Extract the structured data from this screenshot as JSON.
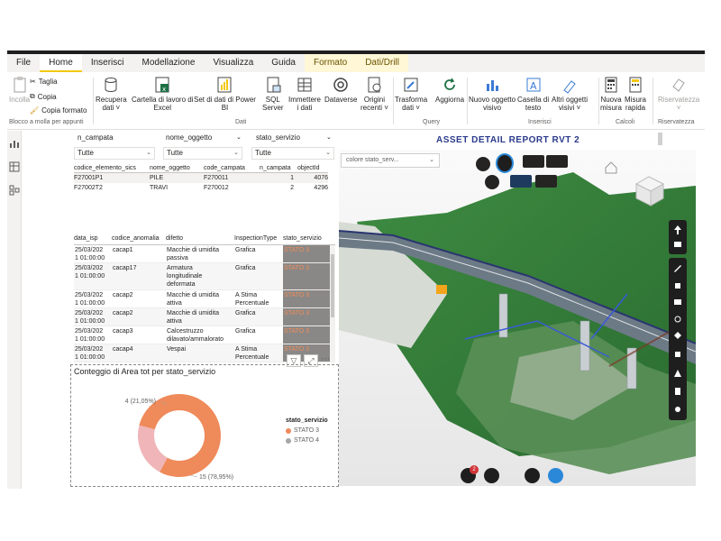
{
  "ribbon": {
    "tabs": [
      "File",
      "Home",
      "Inserisci",
      "Modellazione",
      "Visualizza",
      "Guida",
      "Formato",
      "Dati/Drill"
    ],
    "clipboard": {
      "incolla": "Incolla",
      "taglia": "Taglia",
      "copia": "Copia",
      "copia_formato": "Copia formato",
      "group": "Blocco a molla per appunti"
    },
    "data": {
      "recupera": [
        "Recupera",
        "dati ˅"
      ],
      "cartella": [
        "Cartella di lavoro di",
        "Excel"
      ],
      "setdati": [
        "Set di dati di Power",
        "BI"
      ],
      "sql": [
        "SQL",
        "Server"
      ],
      "immettere": [
        "Immettere",
        "i dati"
      ],
      "dataverse": "Dataverse",
      "origini": [
        "Origini",
        "recenti ˅"
      ],
      "group": "Dati"
    },
    "query": {
      "trasforma": [
        "Trasforma",
        "dati ˅"
      ],
      "aggiorna": "Aggiorna",
      "group": "Query"
    },
    "inserisci": {
      "nuovo": [
        "Nuovo oggetto",
        "visivo"
      ],
      "casella": [
        "Casella di",
        "testo"
      ],
      "altri": [
        "Altri oggetti",
        "visivi ˅"
      ],
      "group": "Inserisci"
    },
    "calcoli": {
      "nuova": [
        "Nuova",
        "misura"
      ],
      "rapida": [
        "Misura",
        "rapida"
      ],
      "group": "Calcoli"
    },
    "riservatezza": {
      "label": [
        "Riservatezza",
        "˅"
      ],
      "group": "Riservatezza"
    }
  },
  "slicers": [
    {
      "header": "n_campata",
      "value": "Tutte"
    },
    {
      "header": "nome_oggetto",
      "value": "Tutte"
    },
    {
      "header": "stato_servizio",
      "value": "Tutte"
    }
  ],
  "table1": {
    "headers": [
      "codice_elemento_sics",
      "nome_oggetto",
      "code_campata",
      "n_campata",
      "objectId"
    ],
    "rows": [
      [
        "F27001P1",
        "PILE",
        "F270011",
        "1",
        "4076"
      ],
      [
        "F27002T2",
        "TRAVI",
        "F270012",
        "2",
        "4296"
      ]
    ]
  },
  "table2": {
    "headers": [
      "data_isp",
      "codice_anomalia",
      "difetto",
      "InspectionType",
      "stato_servizio"
    ],
    "rows": [
      [
        "25/03/202\n1 01:00:00",
        "cacap1",
        "Macchie di umidita\npassiva",
        "Grafica",
        "STATO 3"
      ],
      [
        "25/03/202\n1 01:00:00",
        "cacap17",
        "Armatura\nlongitudinale\ndeformata",
        "Grafica",
        "STATO 3"
      ],
      [
        "25/03/202\n1 01:00:00",
        "cacap2",
        "Macchie di umidita\nattiva",
        "A Stima\nPercentuale",
        "STATO 3"
      ],
      [
        "25/03/202\n1 01:00:00",
        "cacap2",
        "Macchie di umidita\nattiva",
        "Grafica",
        "STATO 3"
      ],
      [
        "25/03/202\n1 01:00:00",
        "cacap3",
        "Calcestruzzo\ndilavato/ammalorato",
        "Grafica",
        "STATO 3"
      ],
      [
        "25/03/202\n1 01:00:00",
        "cacap4",
        "Vespai",
        "A Stima\nPercentuale",
        "STATO 3"
      ]
    ]
  },
  "chart_data": {
    "type": "pie",
    "title": "Conteggio di Area tot per stato_servizio",
    "legend_title": "stato_servizio",
    "legend_position": "right",
    "donut": true,
    "series": [
      {
        "name": "STATO 3",
        "value": 15,
        "label": "15 (78,95%)",
        "color": "#ef8a5a"
      },
      {
        "name": "STATO 4",
        "value": 4,
        "label": "4 (21,05%)",
        "color": "#f0b5b8"
      }
    ]
  },
  "report": {
    "title": "ASSET DETAIL REPORT RVT 2",
    "colore_placeholder": "colore stato_serv...",
    "notification_count": "2"
  },
  "colors": {
    "accent": "#f2c811",
    "title_blue": "#2b3a8c",
    "stato_bg": "#8a8886",
    "stato_text": "#f28c58"
  }
}
